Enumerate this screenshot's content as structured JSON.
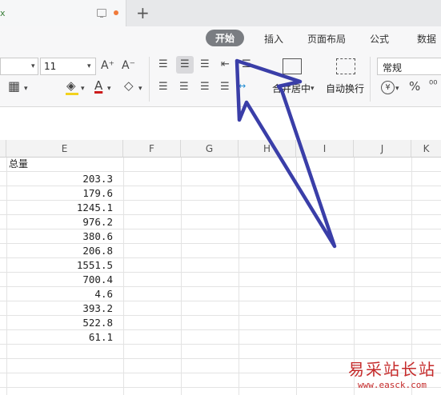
{
  "tabbar": {
    "tab_label": "x",
    "new_tab": "+"
  },
  "ribbon_tabs": [
    "开始",
    "插入",
    "页面布局",
    "公式",
    "数据"
  ],
  "toolbar": {
    "font_size": "11",
    "font_grow": "A⁺",
    "font_shrink": "A⁻",
    "merge_label": "合并居中",
    "wrap_label": "自动换行",
    "number_format": "常规",
    "currency_symbol": "¥",
    "percent_symbol": "%"
  },
  "columns": [
    "E",
    "F",
    "G",
    "H",
    "I",
    "J",
    "K"
  ],
  "header_cell": "总量",
  "values": [
    "203.3",
    "179.6",
    "1245.1",
    "976.2",
    "380.6",
    "206.8",
    "1551.5",
    "700.4",
    "4.6",
    "393.2",
    "522.8",
    "61.1"
  ],
  "watermark": {
    "title": "易采站长站",
    "url": "www.easck.com"
  },
  "colors": {
    "active_tab": "#7a7d82",
    "arrow": "#3a3ea8",
    "watermark": "#c52a2a"
  }
}
